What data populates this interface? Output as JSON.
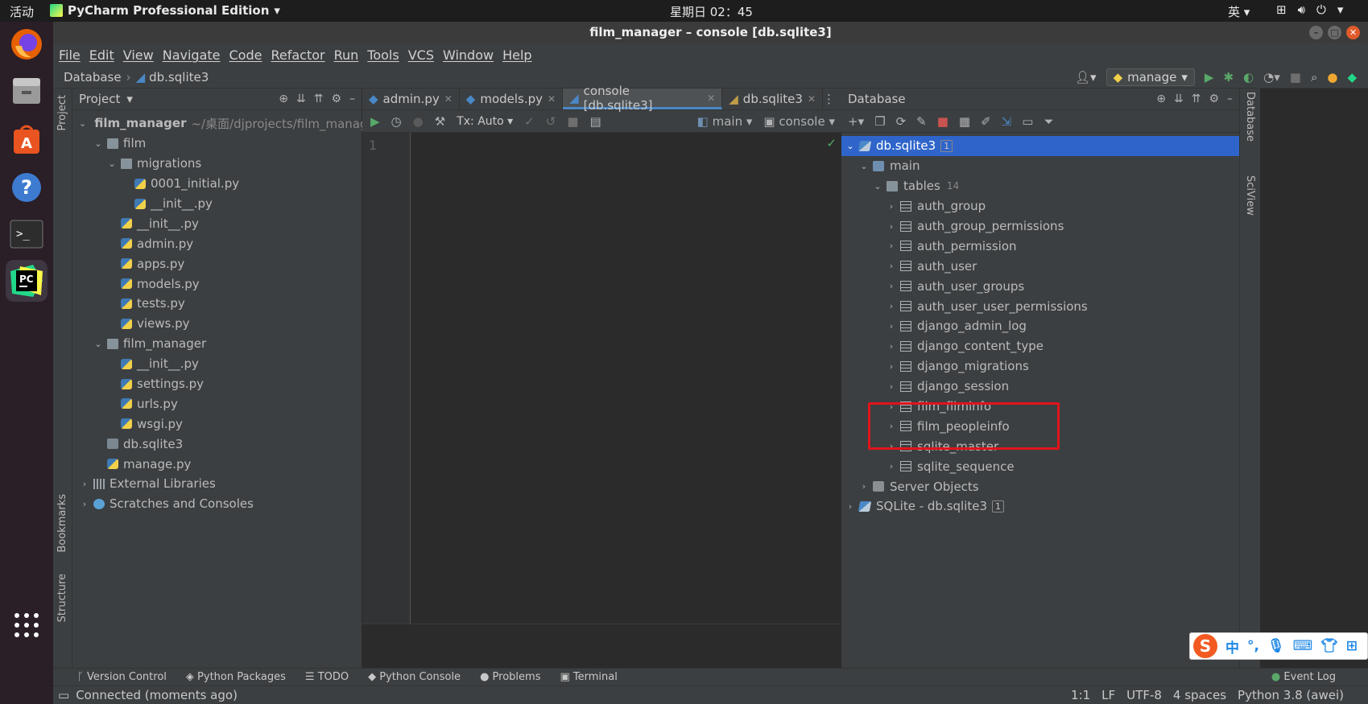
{
  "topbar": {
    "activities": "活动",
    "app_name": "PyCharm Professional Edition",
    "clock": "星期日 02：45",
    "ime": "英"
  },
  "window": {
    "title": "film_manager – console [db.sqlite3]"
  },
  "menu": [
    "File",
    "Edit",
    "View",
    "Navigate",
    "Code",
    "Refactor",
    "Run",
    "Tools",
    "VCS",
    "Window",
    "Help"
  ],
  "breadcrumb": {
    "root": "Database",
    "item": "db.sqlite3"
  },
  "run_config": "manage",
  "left_stripe": {
    "project": "Project",
    "bookmarks": "Bookmarks",
    "structure": "Structure"
  },
  "project": {
    "title": "Project",
    "tree": [
      {
        "label": "film_manager",
        "path": "~/桌面/djprojects/film_manager",
        "depth": 0,
        "type": "folder",
        "expanded": true,
        "bold": true
      },
      {
        "label": "film",
        "depth": 1,
        "type": "folder",
        "expanded": true
      },
      {
        "label": "migrations",
        "depth": 2,
        "type": "folder",
        "expanded": true
      },
      {
        "label": "0001_initial.py",
        "depth": 3,
        "type": "py"
      },
      {
        "label": "__init__.py",
        "depth": 3,
        "type": "py"
      },
      {
        "label": "__init__.py",
        "depth": 2,
        "type": "py"
      },
      {
        "label": "admin.py",
        "depth": 2,
        "type": "py"
      },
      {
        "label": "apps.py",
        "depth": 2,
        "type": "py"
      },
      {
        "label": "models.py",
        "depth": 2,
        "type": "py"
      },
      {
        "label": "tests.py",
        "depth": 2,
        "type": "py"
      },
      {
        "label": "views.py",
        "depth": 2,
        "type": "py"
      },
      {
        "label": "film_manager",
        "depth": 1,
        "type": "folder",
        "expanded": true
      },
      {
        "label": "__init__.py",
        "depth": 2,
        "type": "py"
      },
      {
        "label": "settings.py",
        "depth": 2,
        "type": "py"
      },
      {
        "label": "urls.py",
        "depth": 2,
        "type": "py"
      },
      {
        "label": "wsgi.py",
        "depth": 2,
        "type": "py"
      },
      {
        "label": "db.sqlite3",
        "depth": 1,
        "type": "db"
      },
      {
        "label": "manage.py",
        "depth": 1,
        "type": "py"
      },
      {
        "label": "External Libraries",
        "depth": 0,
        "type": "lib",
        "expanded": false
      },
      {
        "label": "Scratches and Consoles",
        "depth": 0,
        "type": "scratch",
        "expanded": false
      }
    ]
  },
  "editor": {
    "tabs": [
      {
        "label": "admin.py",
        "active": false
      },
      {
        "label": "models.py",
        "active": false
      },
      {
        "label": "console [db.sqlite3]",
        "active": true
      },
      {
        "label": "db.sqlite3",
        "active": false
      }
    ],
    "tx_mode": "Tx: Auto",
    "schema": "main",
    "console": "console",
    "line_number": "1"
  },
  "database": {
    "title": "Database",
    "tree": [
      {
        "label": "db.sqlite3",
        "depth": 0,
        "type": "sqlite",
        "badge": "1",
        "selected": true,
        "expanded": true
      },
      {
        "label": "main",
        "depth": 1,
        "type": "schema",
        "expanded": true
      },
      {
        "label": "tables",
        "depth": 2,
        "type": "folder",
        "count": "14",
        "expanded": true
      },
      {
        "label": "auth_group",
        "depth": 3,
        "type": "table"
      },
      {
        "label": "auth_group_permissions",
        "depth": 3,
        "type": "table"
      },
      {
        "label": "auth_permission",
        "depth": 3,
        "type": "table"
      },
      {
        "label": "auth_user",
        "depth": 3,
        "type": "table"
      },
      {
        "label": "auth_user_groups",
        "depth": 3,
        "type": "table"
      },
      {
        "label": "auth_user_user_permissions",
        "depth": 3,
        "type": "table"
      },
      {
        "label": "django_admin_log",
        "depth": 3,
        "type": "table"
      },
      {
        "label": "django_content_type",
        "depth": 3,
        "type": "table"
      },
      {
        "label": "django_migrations",
        "depth": 3,
        "type": "table"
      },
      {
        "label": "django_session",
        "depth": 3,
        "type": "table"
      },
      {
        "label": "film_filminfo",
        "depth": 3,
        "type": "table"
      },
      {
        "label": "film_peopleinfo",
        "depth": 3,
        "type": "table"
      },
      {
        "label": "sqlite_master",
        "depth": 3,
        "type": "table"
      },
      {
        "label": "sqlite_sequence",
        "depth": 3,
        "type": "table"
      },
      {
        "label": "Server Objects",
        "depth": 1,
        "type": "server"
      },
      {
        "label": "SQLite - db.sqlite3",
        "depth": 0,
        "type": "sqlite",
        "badge": "1"
      }
    ]
  },
  "right_stripe": {
    "database": "Database",
    "sciview": "SciView"
  },
  "bottom_tools": [
    "Version Control",
    "Python Packages",
    "TODO",
    "Python Console",
    "Problems",
    "Terminal"
  ],
  "event_log": "Event Log",
  "status": {
    "message": "Connected (moments ago)",
    "position": "1:1",
    "line_sep": "LF",
    "encoding": "UTF-8",
    "indent": "4 spaces",
    "interpreter": "Python 3.8 (awei)"
  },
  "ime_bar": {
    "logo": "S",
    "mode": "中"
  },
  "colors": {
    "selection": "#2f65ca",
    "highlight_box": "#e0141b",
    "accent_tab": "#4a88c7"
  }
}
